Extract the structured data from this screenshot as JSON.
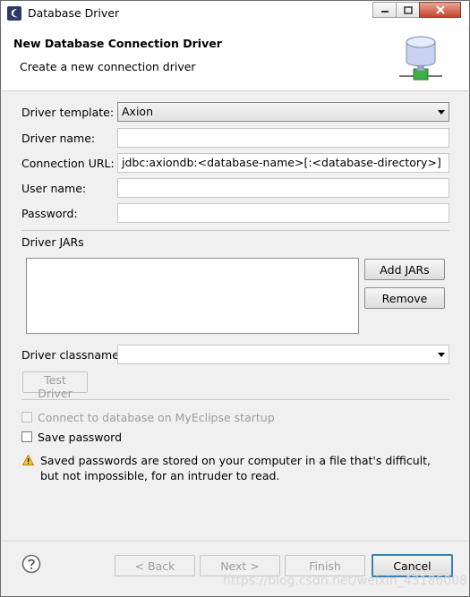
{
  "window": {
    "title": "Database Driver"
  },
  "header": {
    "title": "New Database Connection Driver",
    "subtitle": "Create a new connection driver"
  },
  "form": {
    "driver_template": {
      "label": "Driver template:",
      "value": "Axion"
    },
    "driver_name": {
      "label": "Driver name:",
      "value": ""
    },
    "connection_url": {
      "label": "Connection URL:",
      "value": "jdbc:axiondb:<database-name>[:<database-directory>]"
    },
    "user_name": {
      "label": "User name:",
      "value": ""
    },
    "password": {
      "label": "Password:",
      "value": ""
    },
    "driver_jars": {
      "label": "Driver JARs",
      "items": []
    },
    "add_jars_label": "Add JARs",
    "remove_label": "Remove",
    "driver_classname": {
      "label": "Driver classname:",
      "value": ""
    },
    "test_driver_label": "Test Driver",
    "connect_on_startup": {
      "label": "Connect to database on MyEclipse startup",
      "checked": false,
      "enabled": false
    },
    "save_password": {
      "label": "Save password",
      "checked": false
    },
    "warning": "Saved passwords are stored on your computer in a file that's difficult, but not impossible, for an intruder to read."
  },
  "footer": {
    "back_label": "< Back",
    "next_label": "Next >",
    "finish_label": "Finish",
    "cancel_label": "Cancel"
  },
  "watermark": "https://blog.csdn.net/weixin_43186008",
  "colors": {
    "default_button_border": "#3c7fb1",
    "close_button": "#c7442c",
    "warning": "#e8b400"
  }
}
